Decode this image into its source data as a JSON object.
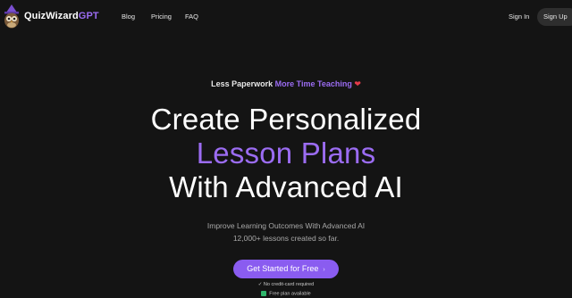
{
  "header": {
    "brand_main": "QuizWizard",
    "brand_accent": "GPT",
    "nav": [
      {
        "label": "Blog"
      },
      {
        "label": "Pricing"
      },
      {
        "label": "FAQ"
      }
    ],
    "signin_label": "Sign In",
    "signup_label": "Sign Up"
  },
  "hero": {
    "tagline_prefix": "Less Paperwork",
    "tagline_accent": "More Time Teaching",
    "tagline_emoji": "❤",
    "headline_line1": "Create Personalized",
    "headline_line2": "Lesson Plans",
    "headline_line3": "With Advanced AI",
    "subtext_line1": "Improve Learning Outcomes With Advanced AI",
    "subtext_line2": "12,000+ lessons created so far.",
    "cta_label": "Get Started for Free",
    "cta_arrow": "›",
    "note1": "✓ No credit-card required",
    "note2": "Free plan available"
  },
  "colors": {
    "background": "#141414",
    "accent": "#9b6cf2",
    "cta": "#8a5cf0"
  }
}
